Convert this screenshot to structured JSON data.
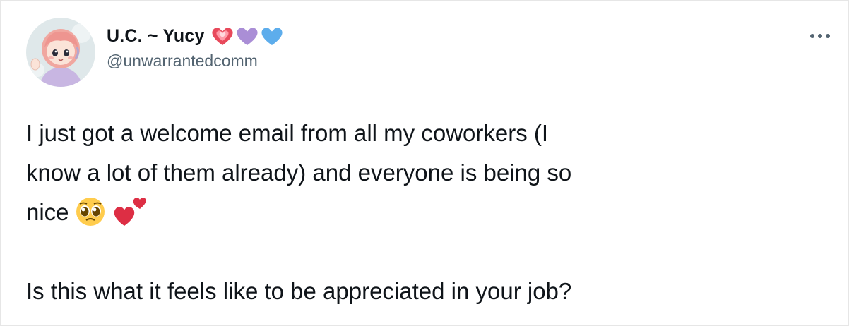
{
  "tweet": {
    "author": {
      "display_name": "U.C. ~ Yucy",
      "handle": "@unwarrantedcomm",
      "avatar_icon": "cartoon-avatar-icon",
      "name_emojis": [
        "sparkling-heart-icon",
        "purple-heart-icon",
        "blue-heart-icon"
      ]
    },
    "more_icon": "more-options-icon",
    "text": {
      "line1": "I just got a welcome email from all my coworkers (I",
      "line2": "know a lot of them already) and everyone is being so",
      "line3": "nice",
      "line3_emojis": [
        "pleading-face-icon",
        "two-hearts-icon"
      ],
      "line5": "Is this what it feels like to be appreciated in your job?"
    }
  }
}
